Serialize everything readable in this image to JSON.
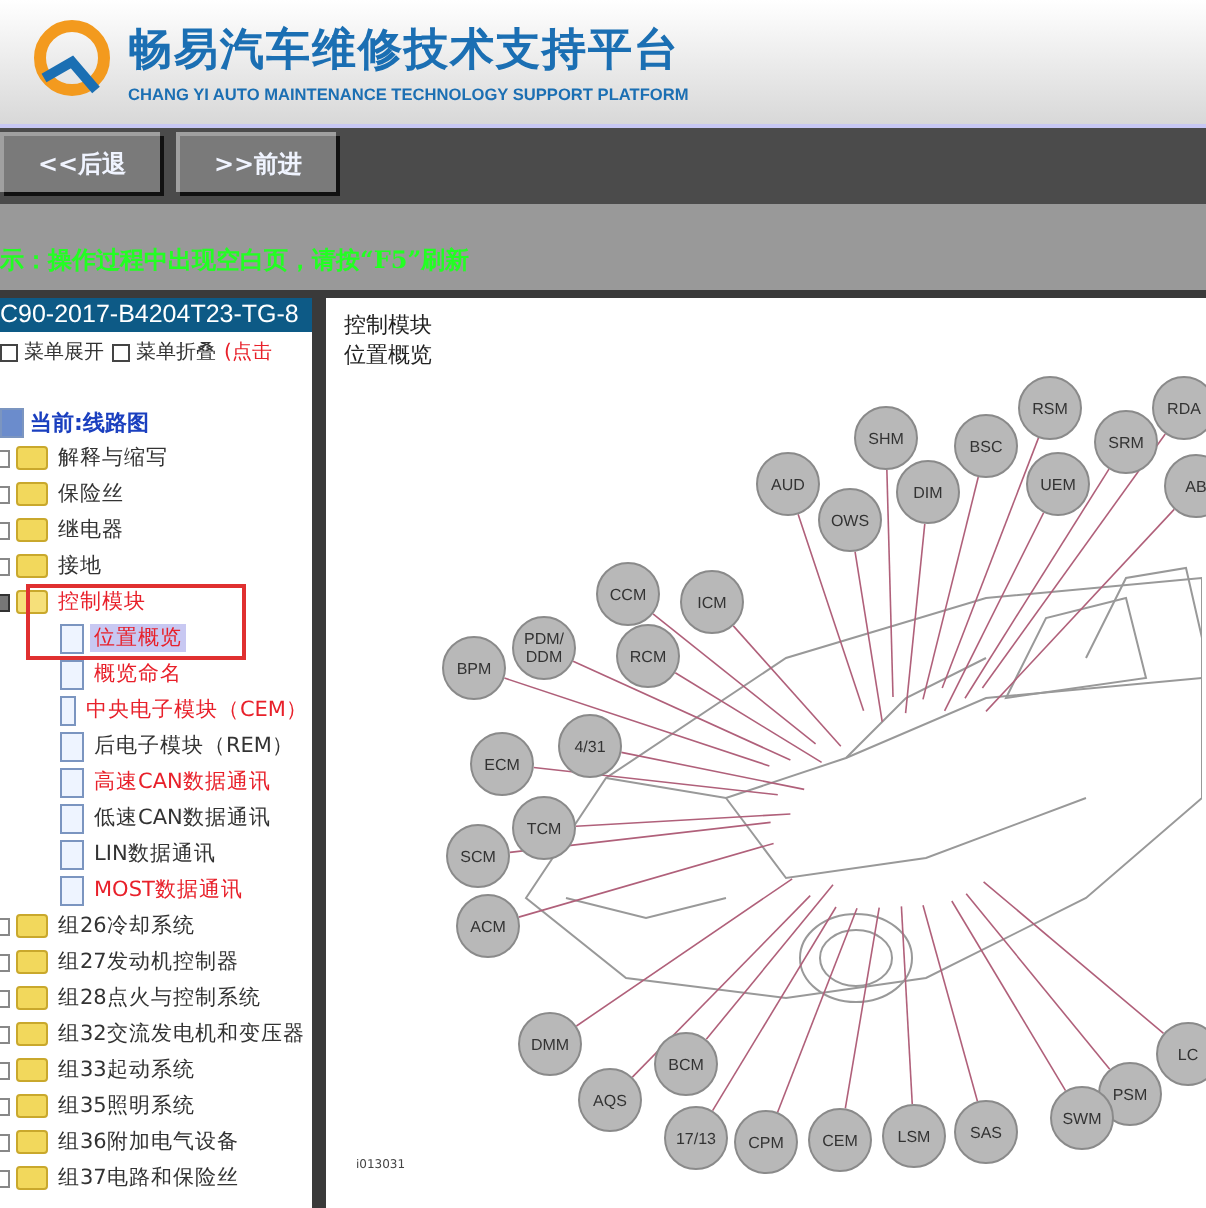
{
  "header": {
    "title": "畅易汽车维修技术支持平台",
    "subtitle": "CHANG YI AUTO MAINTENANCE TECHNOLOGY SUPPORT PLATFORM"
  },
  "nav_buttons": [
    "<<后退",
    ">>前进"
  ],
  "notice": "示：操作过程中出现空白页，请按“F5”刷新",
  "sidebar": {
    "title": "C90-2017-B4204T23-TG-8",
    "menu_actions": [
      "菜单展开",
      "菜单折叠"
    ],
    "menu_hint": "(点击",
    "tree": {
      "label": "当前:线路图",
      "children": [
        {
          "kind": "folder",
          "label": "解释与缩写",
          "color": "#333333",
          "expanded": false,
          "marked": false
        },
        {
          "kind": "folder",
          "label": "保险丝",
          "color": "#333333",
          "expanded": false,
          "marked": false
        },
        {
          "kind": "folder",
          "label": "继电器",
          "color": "#333333",
          "expanded": false,
          "marked": false
        },
        {
          "kind": "folder",
          "label": "接地",
          "color": "#333333",
          "expanded": false,
          "marked": false
        },
        {
          "kind": "folder",
          "label": "控制模块",
          "color": "#e8202a",
          "expanded": true,
          "marked": true,
          "children": [
            {
              "kind": "page",
              "label": "位置概览",
              "color": "#e8202a",
              "selected": true
            },
            {
              "kind": "page",
              "label": "概览命名",
              "color": "#e8202a",
              "selected": false
            },
            {
              "kind": "page",
              "label": "中央电子模块（CEM）",
              "color": "#e8202a",
              "selected": false
            },
            {
              "kind": "page",
              "label": "后电子模块（REM）",
              "color": "#333333",
              "selected": false
            },
            {
              "kind": "page",
              "label": "高速CAN数据通讯",
              "color": "#e8202a",
              "selected": false
            },
            {
              "kind": "page",
              "label": "低速CAN数据通讯",
              "color": "#333333",
              "selected": false
            },
            {
              "kind": "page",
              "label": "LIN数据通讯",
              "color": "#333333",
              "selected": false
            },
            {
              "kind": "page",
              "label": "MOST数据通讯",
              "color": "#e8202a",
              "selected": false
            }
          ]
        },
        {
          "kind": "folder",
          "label": "组26冷却系统",
          "color": "#333333",
          "expanded": false,
          "marked": false
        },
        {
          "kind": "folder",
          "label": "组27发动机控制器",
          "color": "#333333",
          "expanded": false,
          "marked": false
        },
        {
          "kind": "folder",
          "label": "组28点火与控制系统",
          "color": "#333333",
          "expanded": false,
          "marked": false
        },
        {
          "kind": "folder",
          "label": "组32交流发电机和变压器",
          "color": "#333333",
          "expanded": false,
          "marked": false
        },
        {
          "kind": "folder",
          "label": "组33起动系统",
          "color": "#333333",
          "expanded": false,
          "marked": false
        },
        {
          "kind": "folder",
          "label": "组35照明系统",
          "color": "#333333",
          "expanded": false,
          "marked": false
        },
        {
          "kind": "folder",
          "label": "组36附加电气设备",
          "color": "#333333",
          "expanded": false,
          "marked": false
        },
        {
          "kind": "folder",
          "label": "组37电路和保险丝",
          "color": "#333333",
          "expanded": false,
          "marked": false
        }
      ]
    }
  },
  "content": {
    "heading": [
      "控制模块",
      "位置概览"
    ],
    "diagram": {
      "modules": [
        "RSM",
        "RDA",
        "SHM",
        "BSC",
        "SRM",
        "AUD",
        "DIM",
        "UEM",
        "AB",
        "OWS",
        "CCM",
        "ICM",
        "BPM",
        "PDM/\nDDM",
        "RCM",
        "ECM",
        "4/31",
        "TCM",
        "SCM",
        "ACM",
        "DMM",
        "BCM",
        "LC",
        "AQS",
        "PSM",
        "17/13",
        "CPM",
        "CEM",
        "LSM",
        "SAS",
        "SWM"
      ],
      "figure_id": "i013031"
    }
  }
}
